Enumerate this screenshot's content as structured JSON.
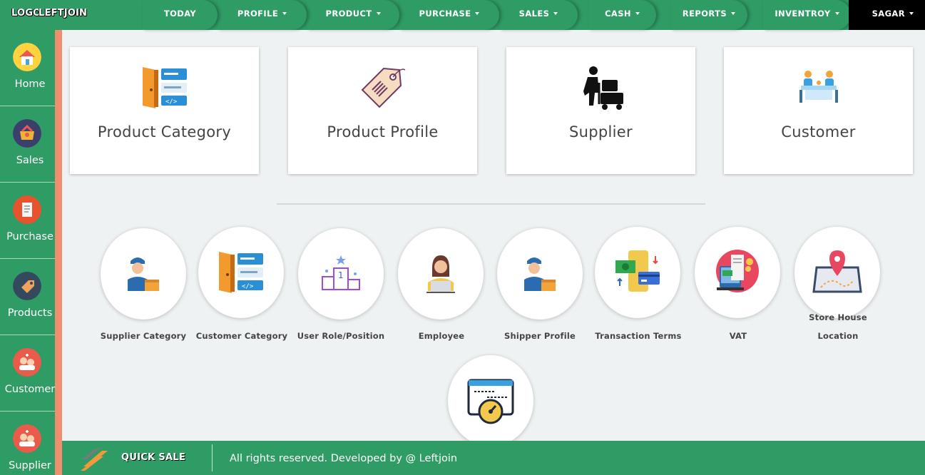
{
  "header": {
    "logo": "LOGO",
    "brand": "LEFTJOIN",
    "nav": [
      {
        "label": "TODAY",
        "dropdown": false
      },
      {
        "label": "PROFILE",
        "dropdown": true
      },
      {
        "label": "PRODUCT",
        "dropdown": true
      },
      {
        "label": "PURCHASE",
        "dropdown": true
      },
      {
        "label": "SALES",
        "dropdown": true
      },
      {
        "label": "CASH",
        "dropdown": true
      },
      {
        "label": "REPORTS",
        "dropdown": true
      },
      {
        "label": "INVENTROY",
        "dropdown": true
      }
    ],
    "user": "SAGAR"
  },
  "sidebar": {
    "items": [
      {
        "label": "Home",
        "icon": "home-icon"
      },
      {
        "label": "Sales",
        "icon": "sales-icon"
      },
      {
        "label": "Purchase",
        "icon": "purchase-icon"
      },
      {
        "label": "Products",
        "icon": "products-tag-icon"
      },
      {
        "label": "Customer",
        "icon": "customer-icon"
      },
      {
        "label": "Supplier",
        "icon": "supplier-icon"
      }
    ]
  },
  "cards": [
    {
      "title": "Product Category",
      "icon": "category-door-icon"
    },
    {
      "title": "Product Profile",
      "icon": "price-tag-icon"
    },
    {
      "title": "Supplier",
      "icon": "delivery-worker-icon"
    },
    {
      "title": "Customer",
      "icon": "meeting-table-icon"
    }
  ],
  "circles": [
    {
      "label": "Supplier Category",
      "icon": "worker-box-icon"
    },
    {
      "label": "Customer Category",
      "icon": "category-door-icon"
    },
    {
      "label": "User Role/Position",
      "icon": "podium-icon"
    },
    {
      "label": "Employee",
      "icon": "employee-laptop-icon"
    },
    {
      "label": "Shipper Profile",
      "icon": "worker-box-icon"
    },
    {
      "label": "Transaction Terms",
      "icon": "money-transfer-icon"
    },
    {
      "label": "VAT",
      "icon": "vat-receipt-icon"
    },
    {
      "label": "Store House Location",
      "label_line1": "Store House",
      "label_line2": "Location",
      "icon": "map-pin-icon"
    },
    {
      "label": "",
      "icon": "speed-dashboard-icon"
    }
  ],
  "footer": {
    "quick_sale": "QUICK SALE",
    "rights": "All rights reserved. Developed by @ Leftjoin"
  },
  "colors": {
    "primary": "#2f9b65",
    "accent": "#ef8f6d",
    "background": "#eff2f3"
  }
}
